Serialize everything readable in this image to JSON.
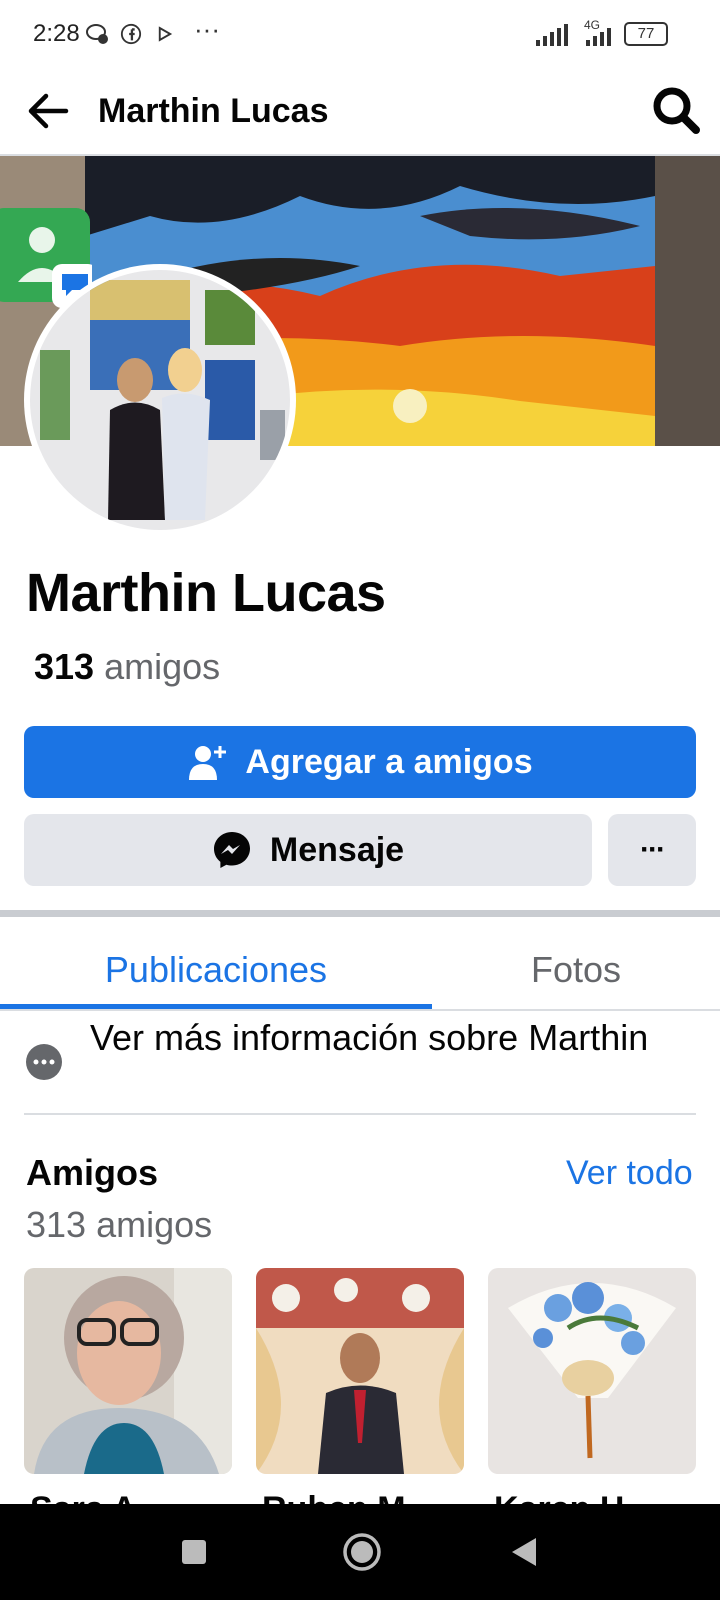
{
  "status_bar": {
    "time": "2:28",
    "battery": "77",
    "network": "4G"
  },
  "header": {
    "title": "Marthin Lucas"
  },
  "profile": {
    "name": "Marthin Lucas",
    "friends_number": "313",
    "friends_word": "amigos"
  },
  "actions": {
    "add_friend_label": "Agregar a amigos",
    "message_label": "Mensaje",
    "more_label": "···"
  },
  "tabs": [
    {
      "label": "Publicaciones",
      "active": true
    },
    {
      "label": "Fotos",
      "active": false
    }
  ],
  "info": {
    "text": "Ver más información sobre Marthin"
  },
  "friends": {
    "title": "Amigos",
    "see_all": "Ver todo",
    "subtitle": "313 amigos",
    "items": [
      {
        "name": "Sara A."
      },
      {
        "name": "Ruben M."
      },
      {
        "name": "Karen H."
      }
    ]
  },
  "colors": {
    "accent": "#1b74e4",
    "button_grey": "#e4e6eb",
    "text_secondary": "#65676b"
  }
}
